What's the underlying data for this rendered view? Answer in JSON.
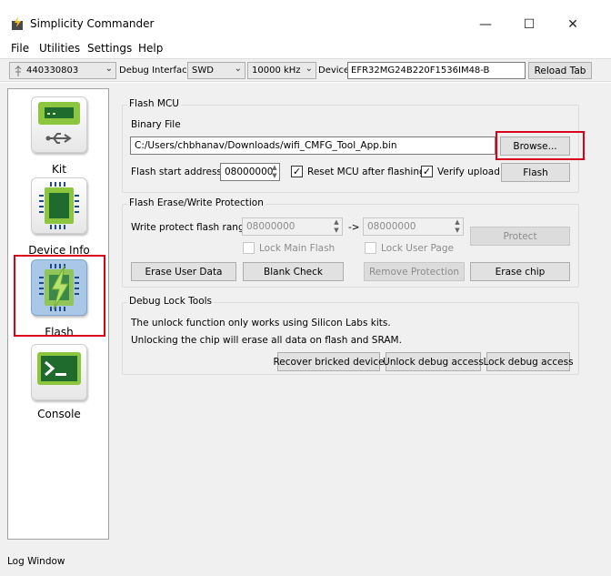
{
  "window": {
    "title": "Simplicity Commander",
    "minimize_glyph": "—",
    "maximize_glyph": "☐",
    "close_glyph": "✕"
  },
  "menu": [
    "File",
    "Utilities",
    "Settings",
    "Help"
  ],
  "toolbar": {
    "adapter": "440330803",
    "debug_interface_label": "Debug Interface",
    "debug_interface": "SWD",
    "speed": "10000 kHz",
    "device_label": "Device",
    "device": "EFR32MG24B220F1536IM48-B",
    "reload_label": "Reload Tab"
  },
  "sidebar": {
    "items": [
      {
        "label": "Kit",
        "icon": "kit-board-icon"
      },
      {
        "label": "Device Info",
        "icon": "chip-icon"
      },
      {
        "label": "Flash",
        "icon": "flash-chip-icon"
      },
      {
        "label": "Console",
        "icon": "console-icon"
      }
    ]
  },
  "flash_mcu": {
    "group_title": "Flash MCU",
    "binary_file_label": "Binary File",
    "binary_file": "C:/Users/chbhanav/Downloads/wifi_CMFG_Tool_App.bin",
    "browse_label": "Browse...",
    "start_address_label": "Flash start address:",
    "start_address": "08000000",
    "reset_label": "Reset MCU after flashing",
    "verify_label": "Verify upload",
    "flash_label": "Flash"
  },
  "erase": {
    "group_title": "Flash Erase/Write Protection",
    "write_protect_label": "Write protect flash range",
    "from": "08000000",
    "arrow": "->",
    "to": "08000000",
    "protect_label": "Protect",
    "lock_main_label": "Lock Main Flash",
    "lock_user_label": "Lock User Page",
    "erase_user_label": "Erase User Data",
    "blank_check_label": "Blank Check",
    "remove_protection_label": "Remove Protection",
    "erase_chip_label": "Erase chip"
  },
  "debug_lock": {
    "group_title": "Debug Lock Tools",
    "info1": "The unlock function only works using Silicon Labs kits.",
    "info2": "Unlocking the chip will erase all data on flash and SRAM.",
    "recover_label": "Recover bricked device",
    "unlock_label": "Unlock debug access",
    "lock_label": "Lock debug access"
  },
  "log": {
    "label": "Log Window"
  },
  "colors": {
    "accent": "#d9001b",
    "tile_green": "#8cc63f",
    "selected_tile": "#a9c8e8"
  }
}
